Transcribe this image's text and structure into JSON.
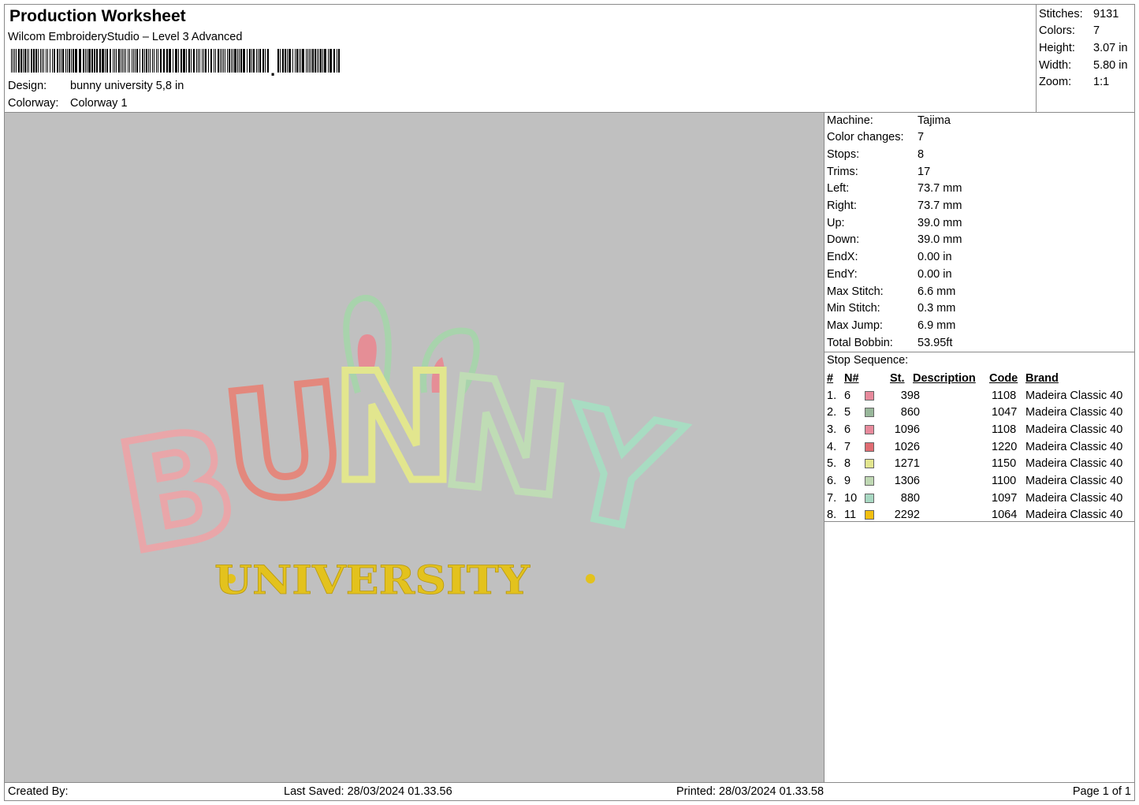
{
  "header": {
    "title": "Production Worksheet",
    "subtitle": "Wilcom EmbroideryStudio – Level 3 Advanced",
    "design_label": "Design:",
    "design_value": "bunny university 5,8 in",
    "colorway_label": "Colorway:",
    "colorway_value": "Colorway 1"
  },
  "stats": [
    {
      "label": "Stitches:",
      "value": "9131"
    },
    {
      "label": "Colors:",
      "value": "7"
    },
    {
      "label": "Height:",
      "value": "3.07 in"
    },
    {
      "label": "Width:",
      "value": "5.80 in"
    },
    {
      "label": "Zoom:",
      "value": "1:1"
    }
  ],
  "machine": [
    {
      "label": "Machine:",
      "value": "Tajima"
    },
    {
      "label": "Color changes:",
      "value": "7"
    },
    {
      "label": "Stops:",
      "value": "8"
    },
    {
      "label": "Trims:",
      "value": "17"
    },
    {
      "label": "Left:",
      "value": "73.7 mm"
    },
    {
      "label": "Right:",
      "value": "73.7 mm"
    },
    {
      "label": "Up:",
      "value": "39.0 mm"
    },
    {
      "label": "Down:",
      "value": "39.0 mm"
    },
    {
      "label": "EndX:",
      "value": "0.00 in"
    },
    {
      "label": "EndY:",
      "value": "0.00 in"
    },
    {
      "label": "Max Stitch:",
      "value": "6.6 mm"
    },
    {
      "label": "Min Stitch:",
      "value": "0.3 mm"
    },
    {
      "label": "Max Jump:",
      "value": "6.9 mm"
    },
    {
      "label": "Total Bobbin:",
      "value": "53.95ft"
    }
  ],
  "stop_sequence": {
    "title": "Stop Sequence:",
    "columns": {
      "num": "#",
      "n": "N#",
      "st": "St.",
      "desc": "Description",
      "code": "Code",
      "brand": "Brand"
    },
    "rows": [
      {
        "num": "1.",
        "n": "6",
        "color": "#e88a9c",
        "st": "398",
        "code": "1108",
        "brand": "Madeira Classic 40"
      },
      {
        "num": "2.",
        "n": "5",
        "color": "#98b79a",
        "st": "860",
        "code": "1047",
        "brand": "Madeira Classic 40"
      },
      {
        "num": "3.",
        "n": "6",
        "color": "#e88a9c",
        "st": "1096",
        "code": "1108",
        "brand": "Madeira Classic 40"
      },
      {
        "num": "4.",
        "n": "7",
        "color": "#e06c72",
        "st": "1026",
        "code": "1220",
        "brand": "Madeira Classic 40"
      },
      {
        "num": "5.",
        "n": "8",
        "color": "#e3e68f",
        "st": "1271",
        "code": "1150",
        "brand": "Madeira Classic 40"
      },
      {
        "num": "6.",
        "n": "9",
        "color": "#bfd8b3",
        "st": "1306",
        "code": "1100",
        "brand": "Madeira Classic 40"
      },
      {
        "num": "7.",
        "n": "10",
        "color": "#a8d8c2",
        "st": "880",
        "code": "1097",
        "brand": "Madeira Classic 40"
      },
      {
        "num": "8.",
        "n": "11",
        "color": "#f2bf10",
        "st": "2292",
        "code": "1064",
        "brand": "Madeira Classic 40"
      }
    ]
  },
  "design": {
    "letters": [
      "B",
      "U",
      "N",
      "N",
      "Y"
    ],
    "letter_colors": [
      "#e9a6a9",
      "#e3887d",
      "#e2e68e",
      "#bfdcb5",
      "#a8dcc2"
    ],
    "subtitle": "UNIVERSITY",
    "subtitle_color": "#e3c21d",
    "ear_outline_color": "#a8d3ac",
    "ear_inner_color": "#e58e96"
  },
  "footer": {
    "created_by": "Created By:",
    "last_saved": "Last Saved: 28/03/2024 01.33.56",
    "printed": "Printed: 28/03/2024 01.33.58",
    "page": "Page 1 of 1"
  }
}
